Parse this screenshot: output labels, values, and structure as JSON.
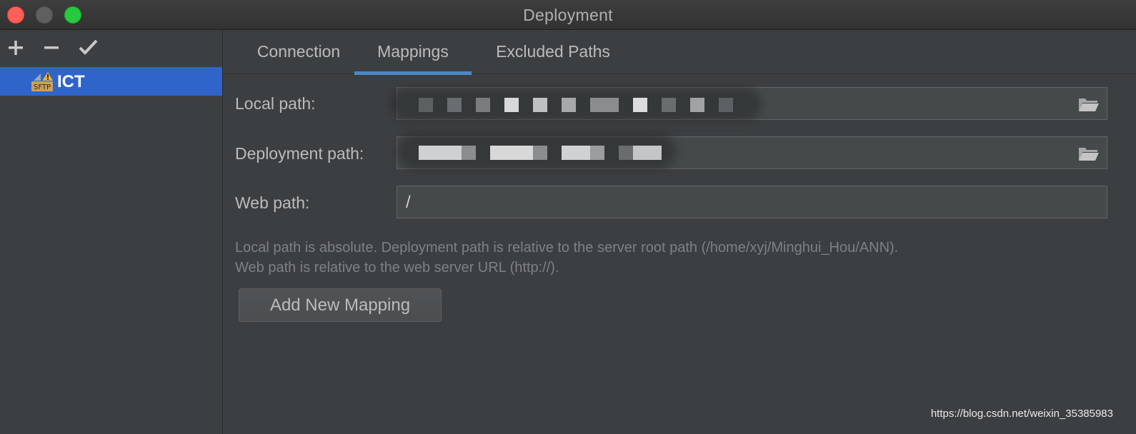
{
  "window": {
    "title": "Deployment",
    "traffic_lights": [
      "close",
      "minimize",
      "zoom"
    ]
  },
  "sidebar": {
    "toolbar": [
      {
        "name": "add",
        "icon": "plus-icon"
      },
      {
        "name": "remove",
        "icon": "minus-icon"
      },
      {
        "name": "set-default",
        "icon": "check-icon"
      }
    ],
    "servers": [
      {
        "label": "ICT",
        "icon": "sftp-server-icon",
        "icon_text": "SFTP",
        "selected": true
      }
    ],
    "selected_color": "#2f65ca"
  },
  "tabs": [
    {
      "label": "Connection",
      "active": false
    },
    {
      "label": "Mappings",
      "active": true
    },
    {
      "label": "Excluded Paths",
      "active": false
    }
  ],
  "mappings": {
    "local_path": {
      "label": "Local path:",
      "value": "",
      "obscured": true,
      "icon": "folder-icon"
    },
    "deployment_path": {
      "label": "Deployment path:",
      "value": "",
      "obscured": true,
      "icon": "folder-icon"
    },
    "web_path": {
      "label": "Web path:",
      "value": "/"
    },
    "hint_line1": "Local path is absolute. Deployment path is relative to the server root path (/home/xyj/Minghui_Hou/ANN).",
    "hint_line2": "Web path is relative to the web server URL (http://).",
    "add_button": "Add New Mapping"
  },
  "watermark": "https://blog.csdn.net/weixin_35385983",
  "colors": {
    "background": "#3c3f41",
    "accent": "#4a88c7",
    "text": "#bbbbbb",
    "hint_text": "#7e8184"
  }
}
